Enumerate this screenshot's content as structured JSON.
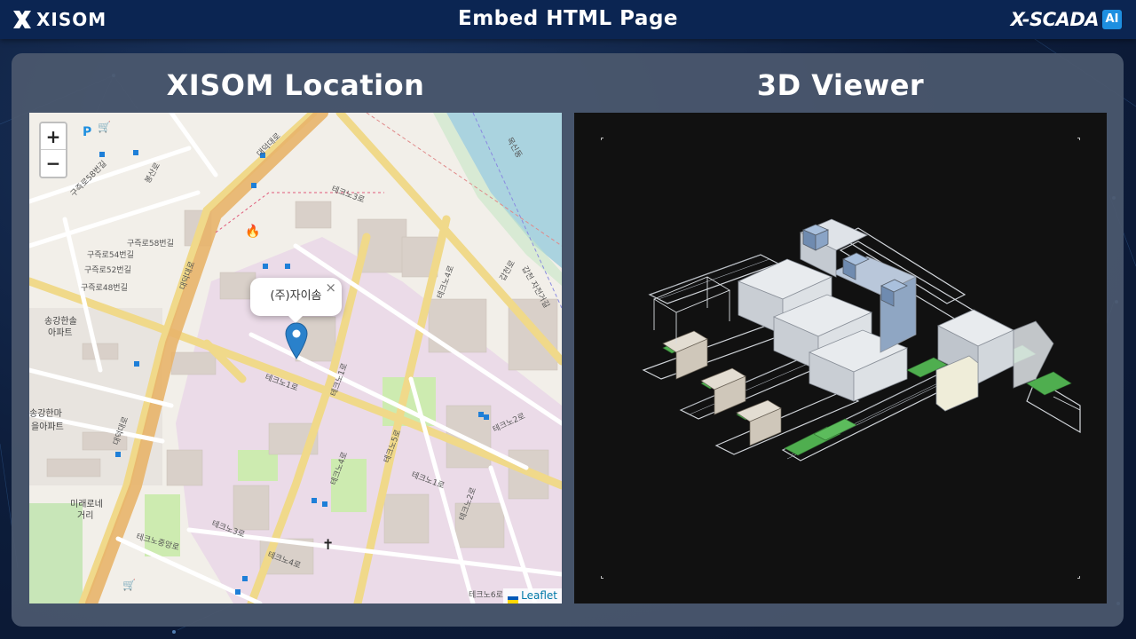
{
  "header": {
    "title": "Embed HTML Page",
    "brand_left": "XISOM",
    "brand_right": "X-SCADA",
    "brand_right_badge": "AI"
  },
  "sections": {
    "map_title": "XISOM Location",
    "viewer_title": "3D Viewer"
  },
  "map": {
    "zoom_in": "+",
    "zoom_out": "−",
    "popup_text": "(주)자이솜",
    "popup_close": "×",
    "attribution": "Leaflet",
    "bottom_right_street": "테크노6로",
    "labels": {
      "techno1": "테크노1로",
      "techno2": "테크노2로",
      "techno3": "테크노3로",
      "techno4": "테크노4로",
      "techno5": "테크노5로",
      "daedeok": "대덕대로",
      "gujuk58": "구즉로58번길",
      "gujuk54": "구즉로54번길",
      "gujuk52": "구즉로52번길",
      "gujuk48": "구즉로48번길",
      "gangbyeon": "갑천로",
      "apt1_a": "송강한솔",
      "apt1_b": "아파트",
      "apt2_a": "송강한마",
      "apt2_b": "을아파트",
      "mirae_a": "미래로네",
      "mirae_b": "거리",
      "techno_jungang": "테크노중앙로",
      "bongsan": "봉산로",
      "gapcheon": "갑천 자전거길",
      "river": "목신동"
    }
  },
  "colors": {
    "accent": "#1e8fe0",
    "header_bg": "#0b2552",
    "panel_bg": "#4b586e",
    "marker": "#2a81cb",
    "viewer_bg": "#111111"
  }
}
